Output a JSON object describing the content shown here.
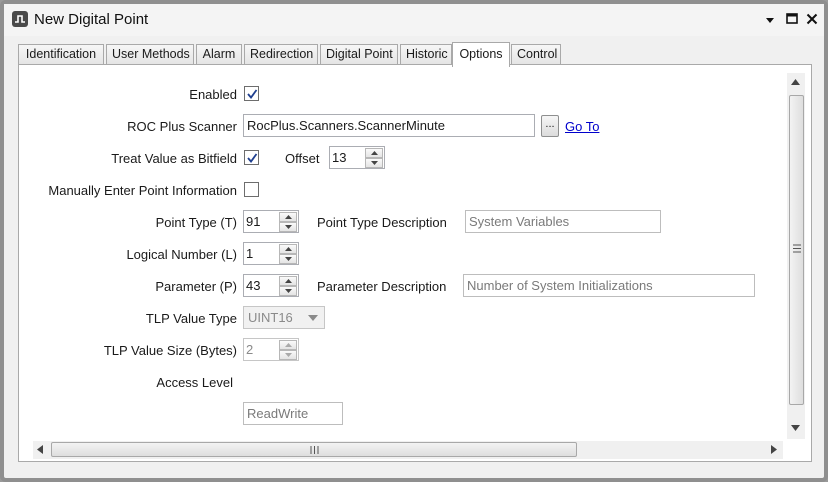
{
  "window": {
    "title": "New Digital Point",
    "icon": "digital-pulse-icon"
  },
  "tabs": [
    {
      "label": "Identification"
    },
    {
      "label": "User Methods"
    },
    {
      "label": "Alarm"
    },
    {
      "label": "Redirection"
    },
    {
      "label": "Digital Point"
    },
    {
      "label": "Historic"
    },
    {
      "label": "Options",
      "active": true
    },
    {
      "label": "Control"
    }
  ],
  "form": {
    "enabled": {
      "label": "Enabled",
      "checked": true
    },
    "roc_scanner": {
      "label": "ROC Plus Scanner",
      "value": "RocPlus.Scanners.ScannerMinute",
      "browse_label": "...",
      "goto_label": "Go To"
    },
    "bitfield": {
      "label": "Treat Value as Bitfield",
      "checked": true,
      "offset_label": "Offset",
      "offset_value": "13"
    },
    "manual": {
      "label": "Manually Enter Point Information",
      "checked": false
    },
    "point_type": {
      "label": "Point Type (T)",
      "value": "91",
      "desc_label": "Point Type Description",
      "desc_value": "System Variables"
    },
    "logical_number": {
      "label": "Logical Number (L)",
      "value": "1"
    },
    "parameter": {
      "label": "Parameter (P)",
      "value": "43",
      "desc_label": "Parameter Description",
      "desc_value": "Number of System Initializations"
    },
    "tlp_type": {
      "label": "TLP Value Type",
      "value": "UINT16"
    },
    "tlp_size": {
      "label": "TLP Value Size (Bytes)",
      "value": "2"
    },
    "access": {
      "label": "Access Level",
      "value": "ReadWrite"
    }
  },
  "colors": {
    "link": "#0000cc",
    "check": "#1f3f8f"
  }
}
